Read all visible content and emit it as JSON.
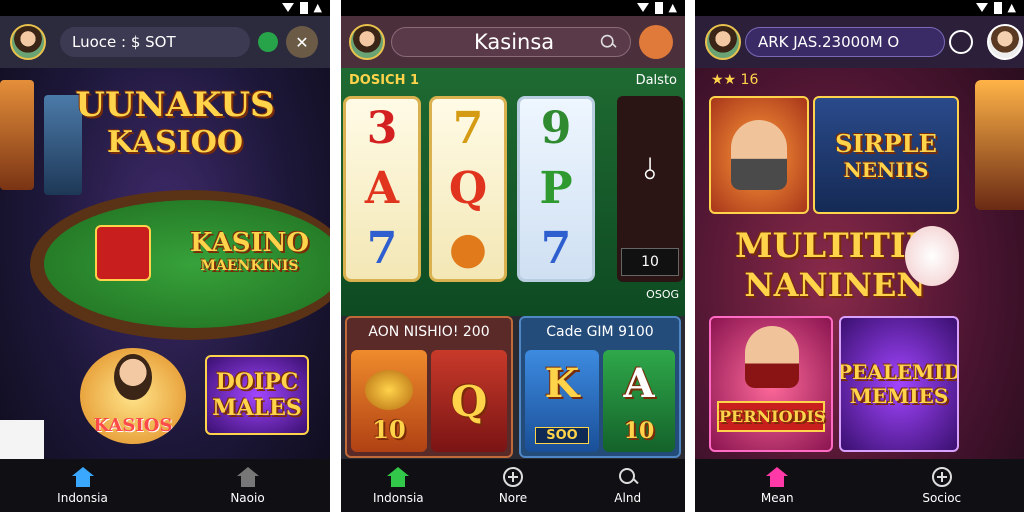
{
  "phone1": {
    "balance_label": "Luoce : $ SOT",
    "nav": [
      {
        "label": "Indonsia"
      },
      {
        "label": "Naoio"
      }
    ],
    "hero_title_line1": "UUNAKUS",
    "hero_title_line2": "KASIOO",
    "table_title_line1": "KASINO",
    "table_title_line2": "MAENKINIS",
    "card1_label": "KASIOS",
    "card2_title_line1": "DOIPC",
    "card2_title_line2": "MALES"
  },
  "phone2": {
    "header_title": "Kasinsa",
    "section_left": "DOSICH 1",
    "section_right": "Dalsto",
    "reels": [
      {
        "symbols": [
          "3",
          "A",
          "7"
        ]
      },
      {
        "symbols": [
          "7",
          "Q",
          "●"
        ]
      },
      {
        "symbols": [
          "9",
          "P",
          "7"
        ]
      }
    ],
    "side_reel_symbol": "⫰",
    "side_reel_value": "10",
    "side_caption": "OSOG",
    "promo_left_title": "AON NISHIO! 200",
    "promo_right_title": "Cade GIM 9100",
    "promo_left_tiles": [
      {
        "value": "10"
      },
      {
        "symbol": "Q"
      }
    ],
    "promo_right_tiles": [
      {
        "symbol": "K",
        "value": "SOO"
      },
      {
        "symbol": "A",
        "value": "10"
      }
    ],
    "nav": [
      {
        "label": "Indonsia"
      },
      {
        "label": "Nore"
      },
      {
        "label": "Alnd"
      }
    ]
  },
  "phone3": {
    "balance_label": "ARK JAS.23000M O",
    "ratings": "★★ 16",
    "card_top_title_line1": "SIRPLE",
    "card_top_title_line2": "NENIIS",
    "hero_title_line1": "MULTITIM",
    "hero_title_line2": "NANINEN",
    "card_bottom_left": "PERNIODIS",
    "card_bottom_right_line1": "PEALEMID",
    "card_bottom_right_line2": "MEMIES",
    "nav": [
      {
        "label": "Mean"
      },
      {
        "label": "Socioc"
      }
    ]
  },
  "colors": {
    "accent_gold": "#ffd34a",
    "felt_green": "#2e8a2e",
    "nav_bg": "#101014",
    "purple": "#5a2a8c"
  }
}
